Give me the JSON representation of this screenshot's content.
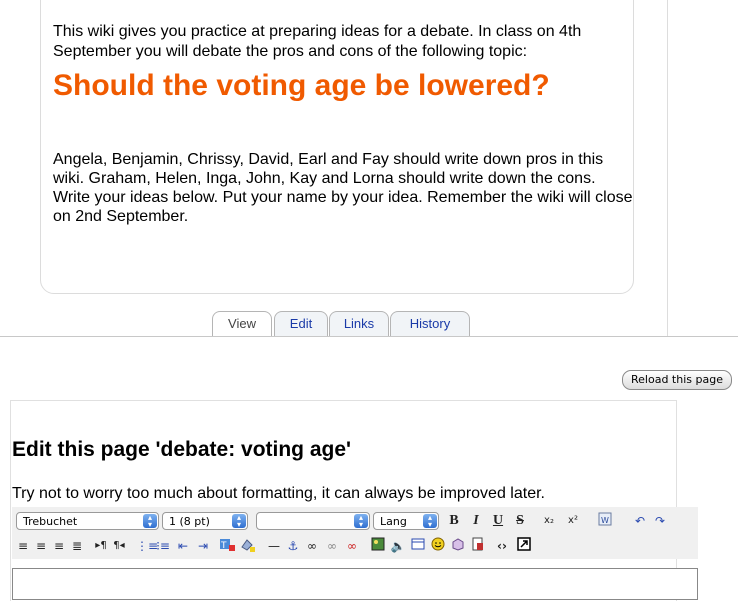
{
  "intro": "This wiki gives you practice at preparing ideas for a debate. In class on 4th September you will debate the pros and cons of the following topic:",
  "topic": "Should the voting age be lowered?",
  "body": "Angela, Benjamin, Chrissy, David, Earl and Fay should write down pros in this wiki. Graham, Helen, Inga, John, Kay and Lorna should write down the cons. Write your ideas below. Put your name by your idea. Remember the wiki will close on 2nd September.",
  "tabs": [
    {
      "label": "View",
      "active": true
    },
    {
      "label": "Edit"
    },
    {
      "label": "Links"
    },
    {
      "label": "History"
    }
  ],
  "reload_label": "Reload this page",
  "edit_heading": "Edit this page 'debate: voting age'",
  "edit_hint": "Try not to worry too much about formatting, it can always be improved later.",
  "toolbar": {
    "font": "Trebuchet",
    "size": "1 (8 pt)",
    "style": "",
    "lang": "Lang",
    "row1_icons": [
      "bold-icon",
      "italic-icon",
      "underline-icon",
      "strikethrough-icon",
      "subscript-icon",
      "superscript-icon",
      "clean-word-icon",
      "undo-icon",
      "redo-icon"
    ],
    "row2_icons": [
      "align-left-icon",
      "align-center-icon",
      "align-right-icon",
      "justify-icon",
      "ltr-icon",
      "rtl-icon",
      "ordered-list-icon",
      "unordered-list-icon",
      "outdent-icon",
      "indent-icon",
      "text-color-icon",
      "background-color-icon",
      "horizontal-rule-icon",
      "anchor-icon",
      "link-icon",
      "unlink-icon",
      "nolink-icon",
      "image-icon",
      "media-icon",
      "table-icon",
      "smiley-icon",
      "special-char-icon",
      "search-replace-icon",
      "html-source-icon",
      "fullscreen-icon"
    ],
    "b": "B",
    "i": "I",
    "u": "U",
    "s": "S",
    "sub": "x₂",
    "sup": "x²"
  }
}
